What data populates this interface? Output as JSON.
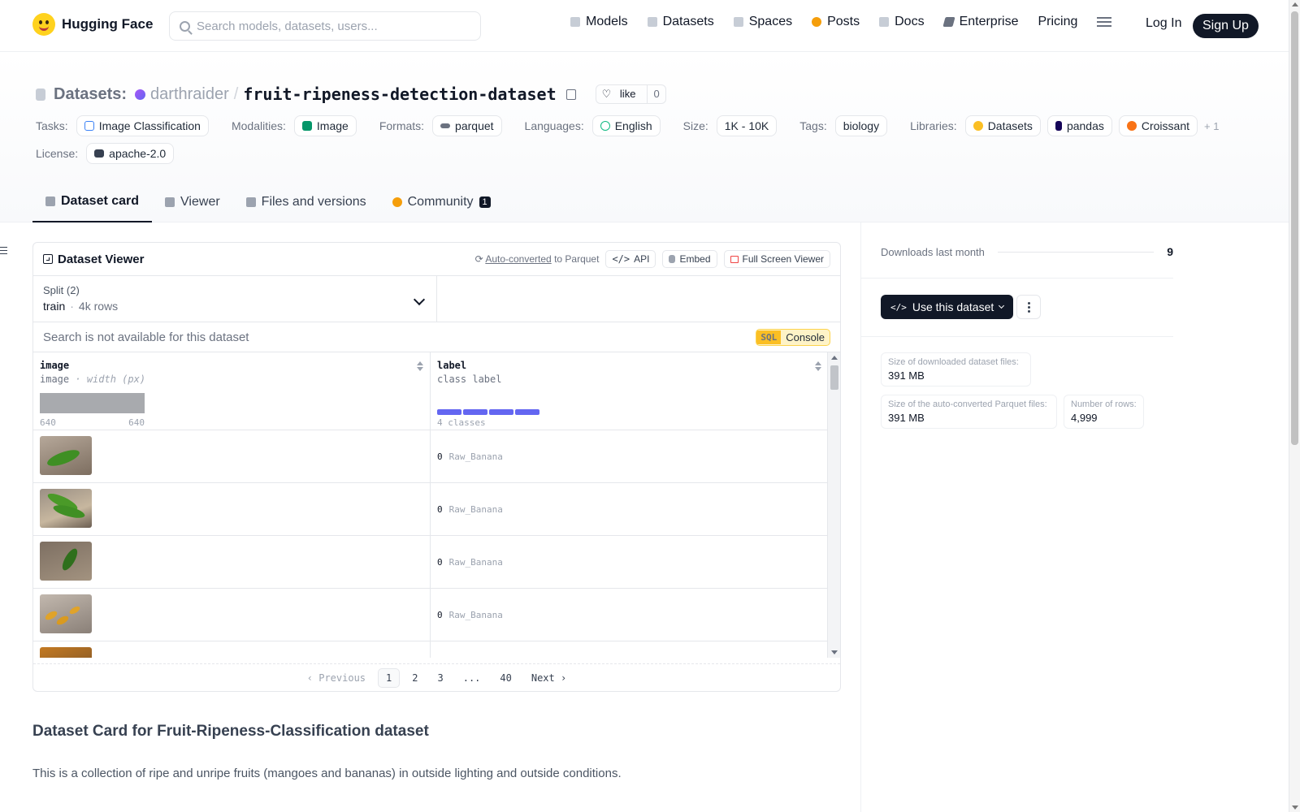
{
  "header": {
    "brand": "Hugging Face",
    "search_placeholder": "Search models, datasets, users...",
    "nav": [
      {
        "label": "Models",
        "icon": "cube-icon"
      },
      {
        "label": "Datasets",
        "icon": "database-icon"
      },
      {
        "label": "Spaces",
        "icon": "grid-icon"
      },
      {
        "label": "Posts",
        "icon": "posts-icon"
      },
      {
        "label": "Docs",
        "icon": "docs-icon"
      },
      {
        "label": "Enterprise",
        "icon": "enterprise-icon"
      },
      {
        "label": "Pricing"
      }
    ],
    "login": "Log In",
    "signup": "Sign Up"
  },
  "repo": {
    "section": "Datasets:",
    "user": "darthraider",
    "slash": "/",
    "name": "fruit-ripeness-detection-dataset",
    "like_label": "like",
    "like_count": "0"
  },
  "tags": {
    "tasks_key": "Tasks:",
    "tasks": "Image Classification",
    "modalities_key": "Modalities:",
    "modalities": "Image",
    "formats_key": "Formats:",
    "formats": "parquet",
    "languages_key": "Languages:",
    "languages": "English",
    "size_key": "Size:",
    "size": "1K - 10K",
    "tags_key": "Tags:",
    "tags": "biology",
    "libraries_key": "Libraries:",
    "libraries": [
      "Datasets",
      "pandas",
      "Croissant"
    ],
    "libraries_more": "+ 1",
    "license_key": "License:",
    "license": "apache-2.0"
  },
  "tabs": [
    {
      "label": "Dataset card",
      "active": true
    },
    {
      "label": "Viewer"
    },
    {
      "label": "Files and versions"
    },
    {
      "label": "Community",
      "badge": "1"
    }
  ],
  "viewer": {
    "title": "Dataset Viewer",
    "converted_link": "Auto-converted",
    "converted_rest": "to Parquet",
    "api": "API",
    "embed": "Embed",
    "fullscreen": "Full Screen Viewer",
    "split_label": "Split (2)",
    "split_value": "train",
    "split_sep": "·",
    "split_rows": "4k rows",
    "search_msg": "Search is not available for this dataset",
    "sql_tag": "SQL",
    "sql_label": "Console",
    "columns": [
      {
        "name": "image",
        "type": "image",
        "type_sep": "·",
        "type_extra": "width (px)",
        "min": "640",
        "max": "640"
      },
      {
        "name": "label",
        "type": "class label",
        "classes": "4 classes"
      }
    ],
    "rows": [
      {
        "label_id": "0",
        "label_name": "Raw_Banana"
      },
      {
        "label_id": "0",
        "label_name": "Raw_Banana"
      },
      {
        "label_id": "0",
        "label_name": "Raw_Banana"
      },
      {
        "label_id": "0",
        "label_name": "Raw_Banana"
      }
    ],
    "pager": {
      "prev": "Previous",
      "pages": [
        "1",
        "2",
        "3",
        "...",
        "40"
      ],
      "next": "Next"
    }
  },
  "card": {
    "heading": "Dataset Card for Fruit-Ripeness-Classification dataset",
    "paragraph": "This is a collection of ripe and unripe fruits (mangoes and bananas) in outside lighting and outside conditions."
  },
  "sidebar": {
    "downloads_label": "Downloads last month",
    "downloads_value": "9",
    "use_button": "Use this dataset",
    "use_button_code": "</>",
    "stats": [
      {
        "key": "Size of downloaded dataset files:",
        "value": "391 MB"
      },
      {
        "key": "Size of the auto-converted Parquet files:",
        "value": "391 MB"
      },
      {
        "key": "Number of rows:",
        "value": "4,999"
      }
    ]
  }
}
